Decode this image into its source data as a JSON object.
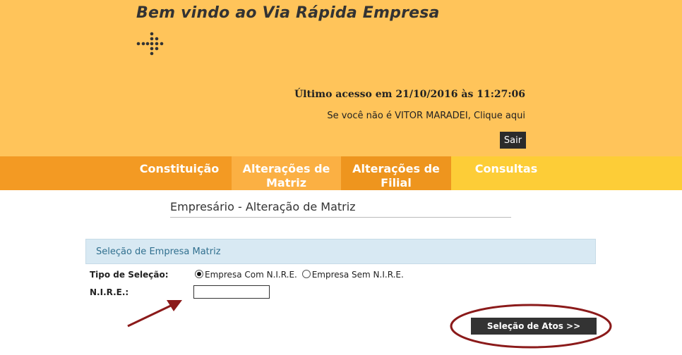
{
  "header": {
    "welcome": "Bem vindo ao Via Rápida Empresa",
    "last_access": "Último acesso em 21/10/2016 às 11:27:06",
    "not_you_prefix": "Se você não é VITOR MARADEI,",
    "not_you_link": "Clique aqui",
    "logout_label": "Sair"
  },
  "nav": {
    "tabs": [
      {
        "label": "Constituição"
      },
      {
        "label": "Alterações de Matriz"
      },
      {
        "label": "Alterações de Filial"
      },
      {
        "label": "Consultas"
      }
    ]
  },
  "page": {
    "title": "Empresário - Alteração de Matriz"
  },
  "form": {
    "panel_title": "Seleção de Empresa Matriz",
    "selection_type_label": "Tipo de Seleção:",
    "option_with_nire": "Empresa Com N.I.R.E.",
    "option_without_nire": "Empresa Sem N.I.R.E.",
    "selected_option": "Empresa Com N.I.R.E.",
    "nire_label": "N.I.R.E.:",
    "nire_value": "",
    "submit_label": "Seleção de Atos >>"
  },
  "colors": {
    "header_bg": "#ffc45a",
    "nav_orange": "#f39a23",
    "nav_yellow": "#fdcd37",
    "annotation": "#8b1a1a"
  },
  "icons": [
    "dot-arrow-logo-icon",
    "annotation-arrow-icon",
    "annotation-ellipse-icon"
  ]
}
